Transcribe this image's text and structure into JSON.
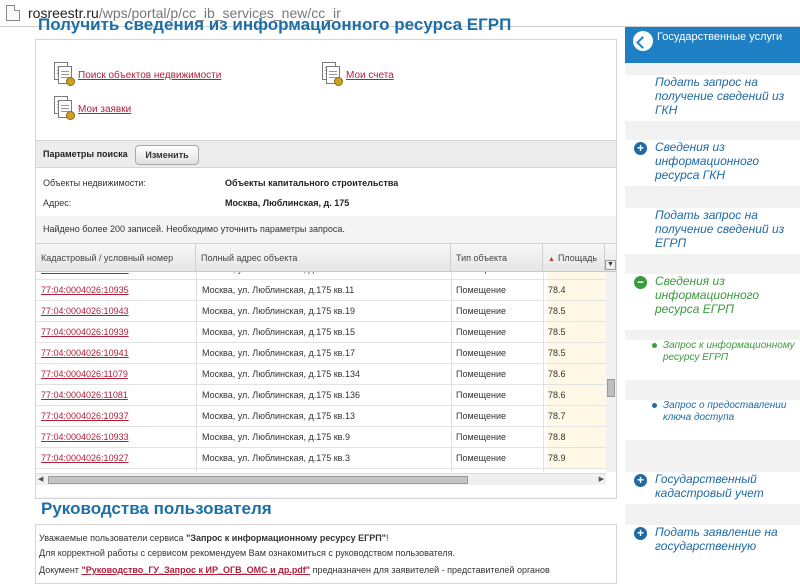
{
  "browser": {
    "url_host": "rosreestr.ru",
    "url_path": "/wps/portal/p/cc_ib_services_new/cc_ir"
  },
  "main": {
    "page_title": "Получить сведения из информационного ресурса ЕГРП",
    "links": {
      "search": "Поиск объектов недвижимости",
      "accounts": "Мои счета",
      "requests": "Мои заявки"
    },
    "params": {
      "label": "Параметры поиска",
      "change_button": "Изменить"
    },
    "fields": [
      {
        "key": "Объекты недвижимости:",
        "value": "Объекты капитального строительства"
      },
      {
        "key": "Адрес:",
        "value": "Москва, Люблинская, д. 175"
      }
    ],
    "found_text": "Найдено более 200 записей. Необходимо уточнить параметры запроса.",
    "table": {
      "columns": [
        "Кадастровый / условный номер",
        "Полный адрес объекта",
        "Тип объекта",
        "Площадь"
      ],
      "rows": [
        [
          "77:04:0004026:10945",
          "Москва, ул. Люблинская, д.175 кв.21",
          "Помещение",
          "78.4"
        ],
        [
          "77:04:0004026:10935",
          "Москва, ул. Люблинская, д.175 кв.11",
          "Помещение",
          "78.4"
        ],
        [
          "77:04:0004026:10943",
          "Москва, ул. Люблинская, д.175 кв.19",
          "Помещение",
          "78.5"
        ],
        [
          "77:04:0004026:10939",
          "Москва, ул. Люблинская, д.175 кв.15",
          "Помещение",
          "78.5"
        ],
        [
          "77:04:0004026:10941",
          "Москва, ул. Люблинская, д.175 кв.17",
          "Помещение",
          "78.5"
        ],
        [
          "77:04:0004026:11079",
          "Москва, ул. Люблинская, д.175 кв.134",
          "Помещение",
          "78.6"
        ],
        [
          "77:04:0004026:11081",
          "Москва, ул. Люблинская, д.175 кв.136",
          "Помещение",
          "78.6"
        ],
        [
          "77:04:0004026:10937",
          "Москва, ул. Люблинская, д.175 кв.13",
          "Помещение",
          "78.7"
        ],
        [
          "77:04:0004026:10933",
          "Москва, ул. Люблинская, д.175 кв.9",
          "Помещение",
          "78.8"
        ],
        [
          "77:04:0004026:10927",
          "Москва, ул. Люблинская, д.175 кв.3",
          "Помещение",
          "78.9"
        ]
      ]
    }
  },
  "guide": {
    "title": "Руководства пользователя",
    "line1_prefix": "Уважаемые пользователи сервиса ",
    "line1_service": "\"Запрос к информационному ресурсу ЕГРП\"",
    "line1_suffix": "!",
    "line2": "Для корректной работы с сервисом рекомендуем Вам ознакомиться с руководством пользователя.",
    "line3_prefix": "Документ ",
    "line3_link": "\"Руководство_ГУ_Запрос к ИР_ОГВ_ОМС и др.pdf\"",
    "line3_suffix": " предназначен для заявителей - представителей органов"
  },
  "sidebar": {
    "header": "Государственные услуги",
    "items": [
      "Подать запрос на получение сведений из ГКН",
      "Сведения из информационного ресурса ГКН",
      "Подать запрос на получение сведений из ЕГРП",
      "Сведения из информационного ресурса ЕГРП",
      "Государственный кадастровый учет",
      "Подать заявление на государственную"
    ],
    "sub_items": [
      "Запрос к информационному ресурсу ЕГРП",
      "Запрос о предоставлении ключа доступа"
    ]
  },
  "colors": {
    "link_red": "#b0203a",
    "brand_blue": "#1f7fc4",
    "sidebar_green": "#3b9a3b"
  }
}
